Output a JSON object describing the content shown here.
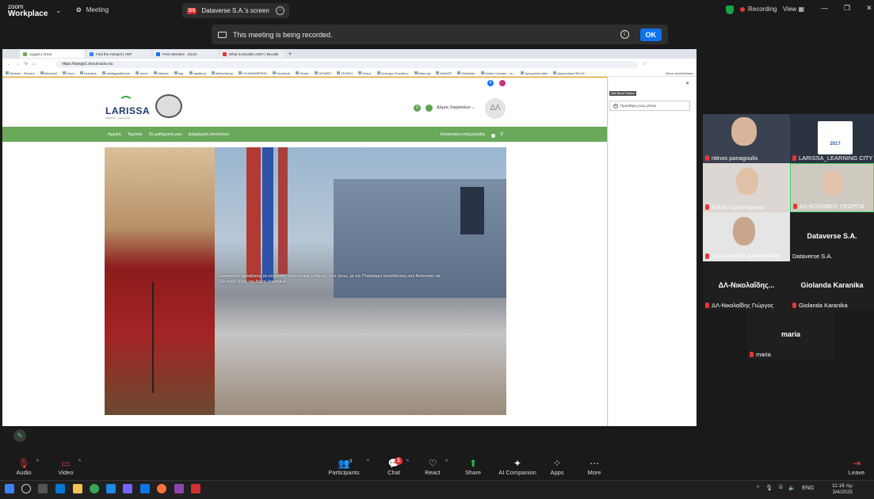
{
  "zoom": {
    "brand_line1": "zoom",
    "brand_line2": "Workplace",
    "meeting_label": "Meeting",
    "screen_pill": {
      "badge": "DS",
      "label": "Dataverse S.A.'s screen"
    },
    "recording_label": "Recording",
    "view_label": "View",
    "banner": {
      "text": "This meeting is being recorded.",
      "ok": "OK"
    }
  },
  "browser": {
    "tabs": [
      {
        "label": "Αρχική | Ιστοσ",
        "color": "#6aa85a"
      },
      {
        "label": "Find the Hotspot | H5P",
        "color": "#3b82f6"
      },
      {
        "label": "Post Attendee - Zoom",
        "color": "#0e72ed"
      },
      {
        "label": "What is Moodle LMS? | Moodle",
        "color": "#e53935"
      }
    ],
    "url": "https://larapp1.docutracks.eu",
    "bookmarks": [
      "Devices - Servers",
      "Microsoft",
      "Cisco",
      "Domains",
      "mindiggo@Azure",
      "Azure",
      "Hetzner",
      "Ingr",
      "capital.gr",
      "lefimerida.gr",
      "Η ΚΑΘΗΜΕΡΙΝΗ",
      "Facebook",
      "Πιπίνε",
      "OKTABIT",
      "ΣΚΙΩΣΗ",
      "DeepL",
      "Σύστημα Ποσοδίων",
      "Meteo.gr",
      "MotoGP",
      "Vittoriclub",
      "Online Courses - Le...",
      "Αρωματικά sites",
      "Δρομολόγια ΗΕLLE..."
    ],
    "bookmarks_more": "Άλλοι σελιδοδείκτες"
  },
  "site": {
    "logo_word": "LARISSA",
    "logo_tag": "UNESCO · learning city",
    "notif_count": "0",
    "user_name": "Δήμος Λαρισαίων",
    "avatar": "ΔΛ",
    "nav": [
      "Αρχική",
      "Ταμπλό",
      "Τα μαθήματά μου",
      "Διαχείριση ιστοτόπου"
    ],
    "nav_edit": "Κατάσταση επεξεργασίας",
    "hero_text": "Δυνατότητα πρόσβασης σε υπηρεσίες ηλεκτρονικής μάθησης, από όλους, με την Πλατφόρμα Εκπαίδευσης από Απόσταση της Έξυπνης Πόλης του Δήμου Λαρισαίων.",
    "side_tip": "Side Block Position",
    "side_add": "Προσθήκη ενός μπλοκ"
  },
  "participants": [
    {
      "name": "ntinos panagoulis",
      "big": ""
    },
    {
      "name": "LARISSA_LEARNING CITY",
      "big": "",
      "logo_year": "2017"
    },
    {
      "name": "Κέλλυ Γεροστέργιου",
      "big": ""
    },
    {
      "name": "ΔΛ-ΚΟΛΟΒΟΥ ΓΕΩΡΓΙΑ",
      "big": ""
    },
    {
      "name": "ΔΛ-ΚΑΦΦΕΣ ΔΗΜΗΤΡΗΣ",
      "big": ""
    },
    {
      "name": "Dataverse S.A.",
      "big": "Dataverse S.A."
    },
    {
      "name": "ΔΛ-Νικολαΐδης Γιώργος",
      "big": "ΔΛ-Νικολαΐδης..."
    },
    {
      "name": "Giolanda Karanika",
      "big": "Giolanda Karanika"
    },
    {
      "name": "maria",
      "big": "maria"
    }
  ],
  "toolbar": {
    "audio": "Audio",
    "video": "Video",
    "participants": "Participants",
    "participants_count": "9",
    "chat": "Chat",
    "chat_badge": "1",
    "react": "React",
    "share": "Share",
    "ai": "AI Companion",
    "apps": "Apps",
    "more": "More",
    "leave": "Leave"
  },
  "taskbar": {
    "lang": "ENG",
    "time": "11:16 πμ",
    "date": "3/4/2025"
  }
}
